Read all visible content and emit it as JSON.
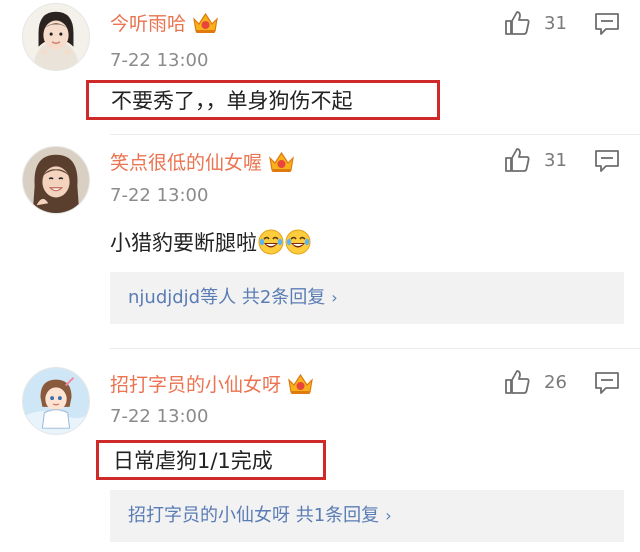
{
  "comments": [
    {
      "username": "今听雨哈",
      "time": "7-22 13:00",
      "content": "不要秀了，，单身狗伤不起",
      "likes": "31",
      "vip_badge": "crown-icon"
    },
    {
      "username": "笑点很低的仙女喔",
      "time": "7-22 13:00",
      "content": "小猎豹要断腿啦",
      "emoji": "laughing-tears-icon",
      "likes": "31",
      "vip_badge": "crown-icon",
      "replies": {
        "name": "njudjdjd",
        "text": "等人 共2条回复",
        "chevron": "›"
      }
    },
    {
      "username": "招打字员的小仙女呀",
      "time": "7-22 13:00",
      "content": "日常虐狗1/1完成",
      "likes": "26",
      "vip_badge": "crown-icon",
      "replies": {
        "name": "招打字员的小仙女呀",
        "text": " 共1条回复",
        "chevron": "›"
      }
    }
  ],
  "colors": {
    "username": "#eb7350",
    "time": "#8b8b8b",
    "highlight_box": "#cf2a2a",
    "reply_link": "#5a7cb5",
    "reply_bg": "#f2f2f2"
  }
}
